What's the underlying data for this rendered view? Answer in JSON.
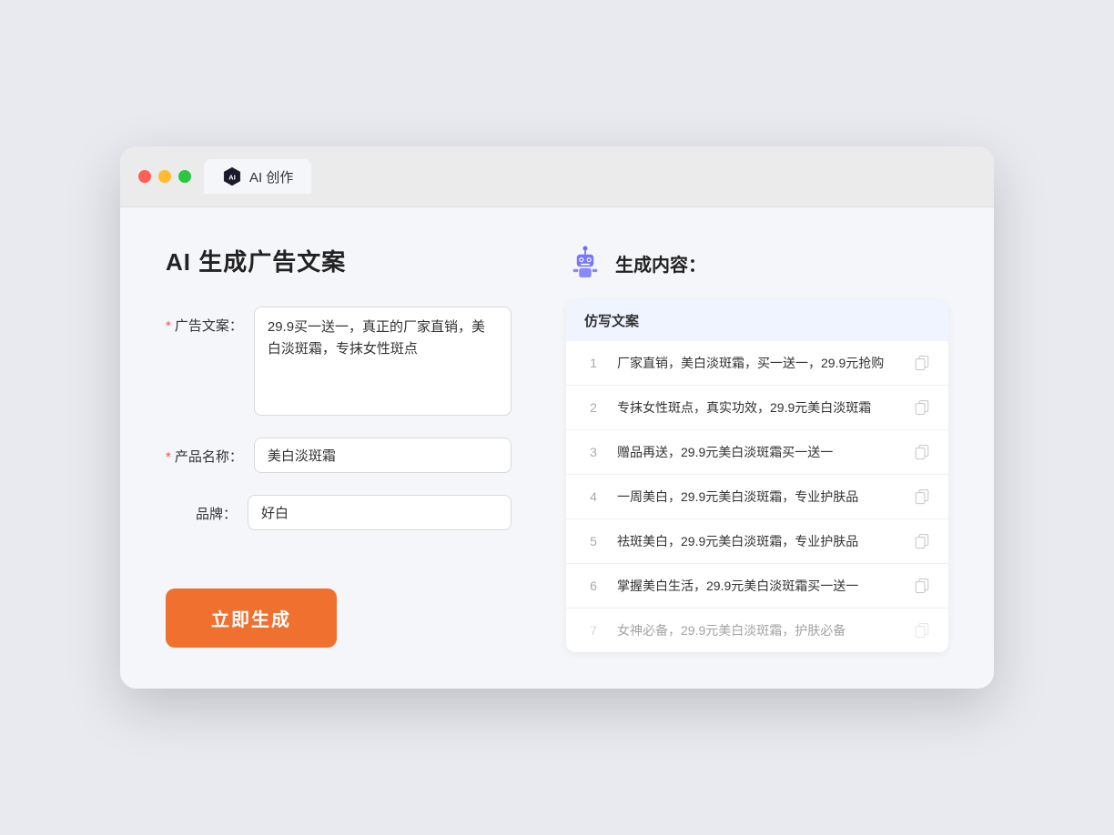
{
  "browser": {
    "tab_label": "AI 创作"
  },
  "page": {
    "title": "AI 生成广告文案",
    "form": {
      "ad_copy_label": "广告文案：",
      "ad_copy_value": "29.9买一送一，真正的厂家直销，美白淡斑霜，专抹女性斑点",
      "product_name_label": "产品名称：",
      "product_name_value": "美白淡斑霜",
      "brand_label": "品牌：",
      "brand_value": "好白",
      "generate_btn_label": "立即生成"
    },
    "result": {
      "header_label": "生成内容：",
      "table_header": "仿写文案",
      "items": [
        {
          "num": 1,
          "text": "厂家直销，美白淡斑霜，买一送一，29.9元抢购",
          "faded": false
        },
        {
          "num": 2,
          "text": "专抹女性斑点，真实功效，29.9元美白淡斑霜",
          "faded": false
        },
        {
          "num": 3,
          "text": "赠品再送，29.9元美白淡斑霜买一送一",
          "faded": false
        },
        {
          "num": 4,
          "text": "一周美白，29.9元美白淡斑霜，专业护肤品",
          "faded": false
        },
        {
          "num": 5,
          "text": "祛斑美白，29.9元美白淡斑霜，专业护肤品",
          "faded": false
        },
        {
          "num": 6,
          "text": "掌握美白生活，29.9元美白淡斑霜买一送一",
          "faded": false
        },
        {
          "num": 7,
          "text": "女神必备，29.9元美白淡斑霜，护肤必备",
          "faded": true
        }
      ]
    }
  }
}
